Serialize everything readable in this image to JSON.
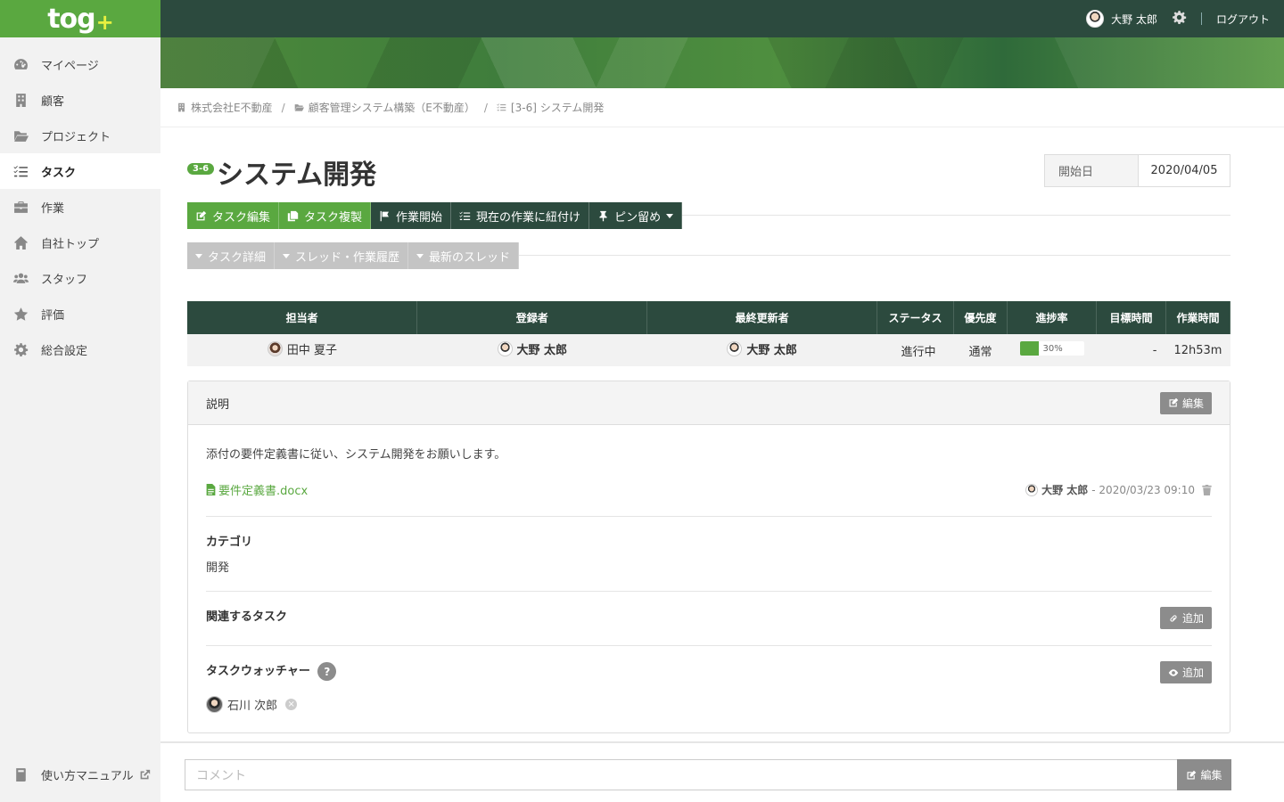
{
  "app": {
    "logo_text": "tog",
    "logo_plus": "+"
  },
  "header": {
    "user_name": "大野 太郎",
    "logout": "ログアウト"
  },
  "sidebar": {
    "items": [
      {
        "label": "マイページ",
        "icon": "dashboard-icon"
      },
      {
        "label": "顧客",
        "icon": "building-icon"
      },
      {
        "label": "プロジェクト",
        "icon": "folder-icon"
      },
      {
        "label": "タスク",
        "icon": "tasks-icon",
        "active": true
      },
      {
        "label": "作業",
        "icon": "briefcase-icon"
      },
      {
        "label": "自社トップ",
        "icon": "home-icon"
      },
      {
        "label": "スタッフ",
        "icon": "users-icon"
      },
      {
        "label": "評価",
        "icon": "star-icon"
      },
      {
        "label": "総合設定",
        "icon": "gear-icon"
      }
    ],
    "manual": "使い方マニュアル"
  },
  "breadcrumb": {
    "company": "株式会社E不動産",
    "project": "顧客管理システム構築（E不動産）",
    "task": "[3-6] システム開発"
  },
  "task": {
    "badge": "3-6",
    "title": "システム開発",
    "start_label": "開始日",
    "start_date": "2020/04/05"
  },
  "actions": {
    "edit": "タスク編集",
    "copy": "タスク複製",
    "start": "作業開始",
    "link": "現在の作業に紐付け",
    "pin": "ピン留め"
  },
  "toggles": {
    "detail": "タスク詳細",
    "thread": "スレッド・作業履歴",
    "latest": "最新のスレッド"
  },
  "table": {
    "headers": {
      "assignee": "担当者",
      "registrant": "登録者",
      "updater": "最終更新者",
      "status": "ステータス",
      "priority": "優先度",
      "progress": "進捗率",
      "target": "目標時間",
      "worktime": "作業時間"
    },
    "row": {
      "assignee": "田中 夏子",
      "registrant": "大野 太郎",
      "updater": "大野 太郎",
      "status": "進行中",
      "priority": "通常",
      "progress": 30,
      "progress_label": "30%",
      "target": "-",
      "worktime": "12h53m"
    }
  },
  "description": {
    "title": "説明",
    "edit": "編集",
    "text": "添付の要件定義書に従い、システム開発をお願いします。",
    "attachment": "要件定義書.docx",
    "author": "大野 太郎",
    "timestamp": "- 2020/03/23 09:10"
  },
  "category": {
    "title": "カテゴリ",
    "value": "開発"
  },
  "related": {
    "title": "関連するタスク",
    "add": "追加"
  },
  "watchers": {
    "title": "タスクウォッチャー",
    "help": "?",
    "add": "追加",
    "user": "石川 次郎"
  },
  "comment": {
    "placeholder": "コメント",
    "button": "編集"
  },
  "colors": {
    "accent_green": "#5aa840",
    "dark_green": "#2c4a3e",
    "gray_button": "#8c8c8c"
  }
}
